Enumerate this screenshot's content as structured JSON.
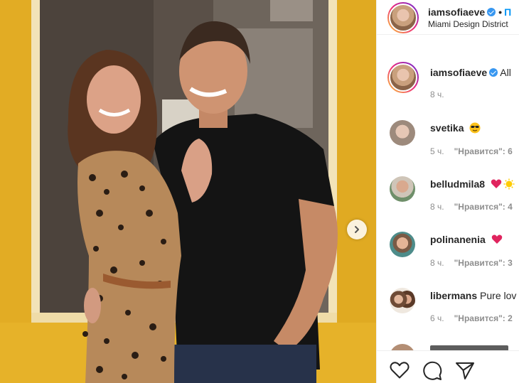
{
  "post": {
    "username": "iamsofiaeve",
    "dot": "•",
    "follow_label": "П",
    "location": "Miami Design District"
  },
  "caption": {
    "username": "iamsofiaeve",
    "text": "All",
    "time": "8 ч."
  },
  "comments": [
    {
      "username": "svetika",
      "text": "",
      "emoji": "sunglasses-emoji",
      "time": "5 ч.",
      "likes": "\"Нравится\": 6"
    },
    {
      "username": "belludmila8",
      "text": "",
      "emoji": "heart-and-sun-emoji",
      "time": "8 ч.",
      "likes": "\"Нравится\": 4"
    },
    {
      "username": "polinanenia",
      "text": "",
      "emoji": "heart-emoji",
      "time": "8 ч.",
      "likes": "\"Нравится\": 3"
    },
    {
      "username": "libermans",
      "text": "Pure lov",
      "emoji": "",
      "time": "6 ч.",
      "likes": "\"Нравится\": 2"
    }
  ],
  "actions": {
    "like_icon": "heart-outline-icon",
    "comment_icon": "speech-bubble-icon",
    "share_icon": "paper-plane-icon"
  },
  "colors": {
    "link_blue": "#0095f6",
    "verified_blue": "#3897f0",
    "heart_red": "#e0245e",
    "wall_yellow": "#e7b52c"
  }
}
